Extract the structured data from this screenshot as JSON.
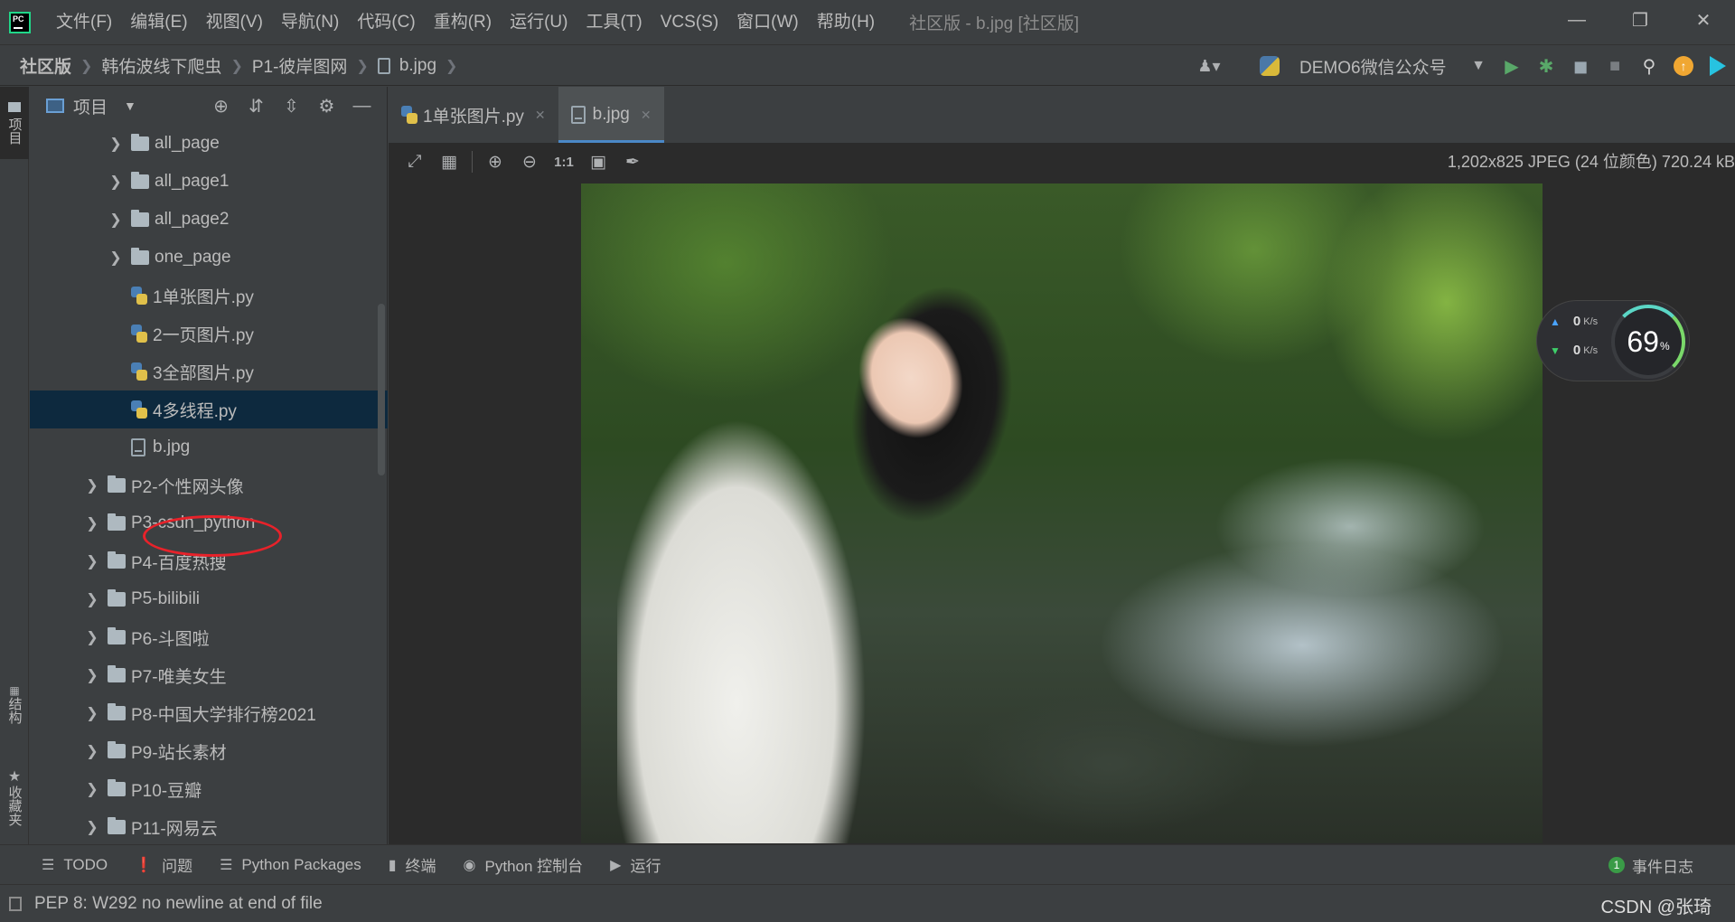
{
  "app": {
    "logo": "PC",
    "menu": [
      "文件(F)",
      "编辑(E)",
      "视图(V)",
      "导航(N)",
      "代码(C)",
      "重构(R)",
      "运行(U)",
      "工具(T)",
      "VCS(S)",
      "窗口(W)",
      "帮助(H)"
    ],
    "window_title": "社区版 - b.jpg [社区版]"
  },
  "breadcrumb": [
    "社区版",
    "韩佑波线下爬虫",
    "P1-彼岸图网",
    "b.jpg"
  ],
  "run_config": "DEMO6微信公众号",
  "left_strip": {
    "project_tab": "项目",
    "structure_tab": "结构",
    "favorites_tab": "收藏夹"
  },
  "project_panel": {
    "title": "项目"
  },
  "tree": [
    {
      "label": "all_page",
      "type": "folder",
      "level": 1,
      "expandable": true
    },
    {
      "label": "all_page1",
      "type": "folder",
      "level": 1,
      "expandable": true
    },
    {
      "label": "all_page2",
      "type": "folder",
      "level": 1,
      "expandable": true
    },
    {
      "label": "one_page",
      "type": "folder",
      "level": 1,
      "expandable": true
    },
    {
      "label": "1单张图片.py",
      "type": "py",
      "level": 1
    },
    {
      "label": "2一页图片.py",
      "type": "py",
      "level": 1
    },
    {
      "label": "3全部图片.py",
      "type": "py",
      "level": 1
    },
    {
      "label": "4多线程.py",
      "type": "py",
      "level": 1,
      "selected": true
    },
    {
      "label": "b.jpg",
      "type": "img",
      "level": 1,
      "circled": true
    },
    {
      "label": "P2-个性网头像",
      "type": "folder",
      "level": 0,
      "expandable": true
    },
    {
      "label": "P3-csdn_python",
      "type": "folder",
      "level": 0,
      "expandable": true
    },
    {
      "label": "P4-百度热搜",
      "type": "folder",
      "level": 0,
      "expandable": true
    },
    {
      "label": "P5-bilibili",
      "type": "folder",
      "level": 0,
      "expandable": true
    },
    {
      "label": "P6-斗图啦",
      "type": "folder",
      "level": 0,
      "expandable": true
    },
    {
      "label": "P7-唯美女生",
      "type": "folder",
      "level": 0,
      "expandable": true
    },
    {
      "label": "P8-中国大学排行榜2021",
      "type": "folder",
      "level": 0,
      "expandable": true
    },
    {
      "label": "P9-站长素材",
      "type": "folder",
      "level": 0,
      "expandable": true
    },
    {
      "label": "P10-豆瓣",
      "type": "folder",
      "level": 0,
      "expandable": true
    },
    {
      "label": "P11-网易云",
      "type": "folder",
      "level": 0,
      "expandable": true
    }
  ],
  "tabs": [
    {
      "label": "1单张图片.py",
      "icon": "python-file-icon",
      "active": false
    },
    {
      "label": "b.jpg",
      "icon": "image-file-icon",
      "active": true
    }
  ],
  "image_viewer": {
    "zoom_actual": "1:1",
    "info": "1,202x825 JPEG (24 位颜色) 720.24 kB"
  },
  "net_widget": {
    "upload": "0",
    "download": "0",
    "unit": "K/s",
    "percent": "69",
    "percent_sign": "%"
  },
  "bottom_tools": [
    {
      "label": "TODO",
      "icon": "list-icon"
    },
    {
      "label": "问题",
      "icon": "warning-icon"
    },
    {
      "label": "Python Packages",
      "icon": "layers-icon"
    },
    {
      "label": "终端",
      "icon": "terminal-icon"
    },
    {
      "label": "Python 控制台",
      "icon": "python-console-icon"
    },
    {
      "label": "运行",
      "icon": "play-icon"
    }
  ],
  "event_log": {
    "count": "1",
    "label": "事件日志"
  },
  "status": {
    "message": "PEP 8: W292 no newline at end of file",
    "watermark": "CSDN @张琦"
  },
  "colors": {
    "accent": "#4a88c7",
    "selection": "#0d293e",
    "annotation_circle": "#e8222a",
    "run_green": "#59a869",
    "update_orange": "#f0a732"
  }
}
